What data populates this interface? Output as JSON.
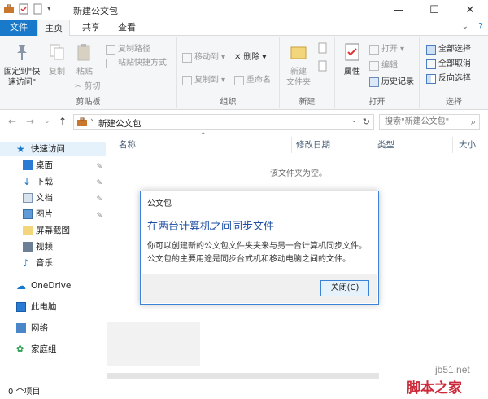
{
  "window": {
    "title": "新建公文包",
    "minimize": "—",
    "maximize": "☐",
    "close": "✕"
  },
  "tabs": [
    "文件",
    "主页",
    "共享",
    "查看"
  ],
  "ribbon": {
    "clipboard": {
      "name": "剪贴板",
      "pin": "固定到\"快\n速访问\"",
      "copy": "复制",
      "paste": "粘贴",
      "copy_path": "复制路径",
      "paste_shortcut": "粘贴快捷方式",
      "cut": "剪切"
    },
    "organize": {
      "name": "组织",
      "move_to": "移动到",
      "copy_to": "复制到",
      "delete": "删除",
      "rename": "重命名"
    },
    "new": {
      "name": "新建",
      "new_folder": "新建\n文件夹"
    },
    "open": {
      "name": "打开",
      "properties": "属性",
      "open": "打开",
      "edit": "编辑",
      "history": "历史记录"
    },
    "select": {
      "name": "选择",
      "select_all": "全部选择",
      "select_none": "全部取消",
      "invert": "反向选择"
    }
  },
  "address": {
    "path": "新建公文包",
    "search_placeholder": "搜索\"新建公文包\""
  },
  "nav": {
    "quick_access": "快速访问",
    "desktop": "桌面",
    "downloads": "下载",
    "documents": "文档",
    "pictures": "图片",
    "screenshots": "屏幕截图",
    "videos": "视频",
    "music": "音乐",
    "onedrive": "OneDrive",
    "this_pc": "此电脑",
    "network": "网络",
    "homegroup": "家庭组"
  },
  "columns": {
    "name": "名称",
    "modified": "修改日期",
    "type": "类型",
    "size": "大小"
  },
  "empty_text": "该文件夹为空。",
  "status": "0 个项目",
  "dialog": {
    "title": "公文包",
    "heading": "在两台计算机之间同步文件",
    "body": "你可以创建新的公文包文件夹夹来与另一台计算机同步文件。公文包的主要用途是同步台式机和移动电脑之间的文件。",
    "close_button": "关闭(C)"
  },
  "watermark": {
    "site": "jb51.net",
    "brand": "脚本之家"
  },
  "colors": {
    "accent": "#1979ca",
    "dialog_heading": "#1e4fa4",
    "nav_selected": "#e5f1fb"
  }
}
